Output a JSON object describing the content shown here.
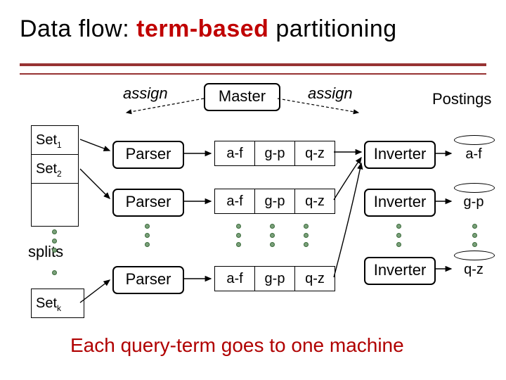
{
  "title": {
    "pre": "Data flow: ",
    "em": "term-based",
    "post": " partitioning"
  },
  "labels": {
    "assign_left": "assign",
    "assign_right": "assign",
    "postings": "Postings",
    "master": "Master",
    "splits": "splits"
  },
  "sets": {
    "s1": "Set",
    "s1sub": "1",
    "s2": "Set",
    "s2sub": "2",
    "sk": "Set",
    "sksub": "k"
  },
  "parsers": {
    "p1": "Parser",
    "p2": "Parser",
    "p3": "Parser"
  },
  "segments": {
    "row1": {
      "a": "a-f",
      "b": "g-p",
      "c": "q-z"
    },
    "row2": {
      "a": "a-f",
      "b": "g-p",
      "c": "q-z"
    },
    "row3": {
      "a": "a-f",
      "b": "g-p",
      "c": "q-z"
    }
  },
  "inverters": {
    "i1": "Inverter",
    "i2": "Inverter",
    "i3": "Inverter"
  },
  "postings_files": {
    "f1": "a-f",
    "f2": "g-p",
    "f3": "q-z"
  },
  "footer": "Each query-term goes to one machine",
  "chart_data": {
    "type": "diagram",
    "title": "Data flow: term-based partitioning",
    "nodes": [
      {
        "id": "master",
        "label": "Master",
        "kind": "process"
      },
      {
        "id": "set1",
        "label": "Set1",
        "kind": "split"
      },
      {
        "id": "set2",
        "label": "Set2",
        "kind": "split"
      },
      {
        "id": "setk",
        "label": "Setk",
        "kind": "split"
      },
      {
        "id": "parser1",
        "label": "Parser",
        "kind": "process"
      },
      {
        "id": "parser2",
        "label": "Parser",
        "kind": "process"
      },
      {
        "id": "parser3",
        "label": "Parser",
        "kind": "process"
      },
      {
        "id": "seg1",
        "label": [
          "a-f",
          "g-p",
          "q-z"
        ],
        "kind": "buffer"
      },
      {
        "id": "seg2",
        "label": [
          "a-f",
          "g-p",
          "q-z"
        ],
        "kind": "buffer"
      },
      {
        "id": "seg3",
        "label": [
          "a-f",
          "g-p",
          "q-z"
        ],
        "kind": "buffer"
      },
      {
        "id": "inverter1",
        "label": "Inverter",
        "kind": "process"
      },
      {
        "id": "inverter2",
        "label": "Inverter",
        "kind": "process"
      },
      {
        "id": "inverter3",
        "label": "Inverter",
        "kind": "process"
      },
      {
        "id": "post_af",
        "label": "a-f",
        "kind": "datastore"
      },
      {
        "id": "post_gp",
        "label": "g-p",
        "kind": "datastore"
      },
      {
        "id": "post_qz",
        "label": "q-z",
        "kind": "datastore"
      }
    ],
    "edges": [
      {
        "from": "master",
        "to": "parser1",
        "label": "assign",
        "style": "dashed"
      },
      {
        "from": "master",
        "to": "parser2",
        "label": "assign",
        "style": "dashed"
      },
      {
        "from": "master",
        "to": "parser3",
        "label": "assign",
        "style": "dashed"
      },
      {
        "from": "master",
        "to": "inverter1",
        "label": "assign",
        "style": "dashed"
      },
      {
        "from": "master",
        "to": "inverter2",
        "label": "assign",
        "style": "dashed"
      },
      {
        "from": "master",
        "to": "inverter3",
        "label": "assign",
        "style": "dashed"
      },
      {
        "from": "set1",
        "to": "parser1"
      },
      {
        "from": "set2",
        "to": "parser2"
      },
      {
        "from": "setk",
        "to": "parser3"
      },
      {
        "from": "parser1",
        "to": "seg1"
      },
      {
        "from": "parser2",
        "to": "seg2"
      },
      {
        "from": "parser3",
        "to": "seg3"
      },
      {
        "from": "seg1",
        "to": "inverter1",
        "term": "a-f"
      },
      {
        "from": "seg2",
        "to": "inverter1",
        "term": "a-f"
      },
      {
        "from": "seg3",
        "to": "inverter1",
        "term": "a-f"
      },
      {
        "from": "seg1",
        "to": "inverter2",
        "term": "g-p"
      },
      {
        "from": "seg2",
        "to": "inverter2",
        "term": "g-p"
      },
      {
        "from": "seg3",
        "to": "inverter2",
        "term": "g-p"
      },
      {
        "from": "seg1",
        "to": "inverter3",
        "term": "q-z"
      },
      {
        "from": "seg2",
        "to": "inverter3",
        "term": "q-z"
      },
      {
        "from": "seg3",
        "to": "inverter3",
        "term": "q-z"
      },
      {
        "from": "inverter1",
        "to": "post_af"
      },
      {
        "from": "inverter2",
        "to": "post_gp"
      },
      {
        "from": "inverter3",
        "to": "post_qz"
      }
    ],
    "caption": "Each query-term goes to one machine"
  }
}
